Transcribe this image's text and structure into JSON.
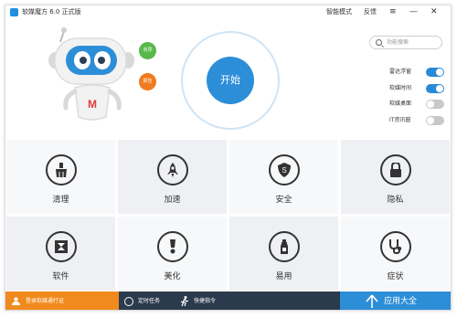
{
  "titlebar": {
    "app_title": "软媒魔方 6.0 正式版",
    "mode_label": "智能模式",
    "feedback_label": "反馈",
    "menu_glyph": "≡",
    "minimize_glyph": "—",
    "close_glyph": "✕"
  },
  "search": {
    "placeholder": "功能搜索"
  },
  "bubbles": {
    "guide": "向导",
    "report": "报告"
  },
  "start": {
    "label": "开始"
  },
  "toggles": [
    {
      "label": "雷达浮窗",
      "on": true
    },
    {
      "label": "软媒时间",
      "on": true
    },
    {
      "label": "软媒桌面",
      "on": false
    },
    {
      "label": "IT资讯窗",
      "on": false
    }
  ],
  "tools": [
    {
      "label": "清理",
      "icon": "broom-icon"
    },
    {
      "label": "加速",
      "icon": "rocket-icon"
    },
    {
      "label": "安全",
      "icon": "shield-icon"
    },
    {
      "label": "隐私",
      "icon": "lock-icon"
    },
    {
      "label": "软件",
      "icon": "aperture-icon"
    },
    {
      "label": "美化",
      "icon": "paint-icon"
    },
    {
      "label": "易用",
      "icon": "bottle-icon"
    },
    {
      "label": "症状",
      "icon": "stethoscope-icon"
    }
  ],
  "bottombar": {
    "login": "登录软媒通行证",
    "timer": "定时任务",
    "quick": "快捷指令",
    "apps": "应用大全"
  },
  "colors": {
    "accent": "#2d8ed8",
    "guide": "#59b84c",
    "report": "#f07a1e",
    "login_bg": "#f08a1c",
    "bottom_bg": "#2b3a4c"
  }
}
